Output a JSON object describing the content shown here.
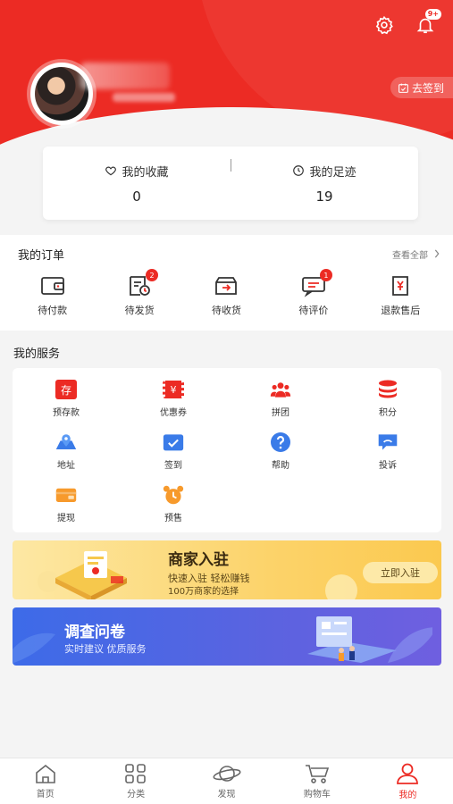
{
  "header": {
    "sign_in_label": "去签到",
    "notification_badge": "9+"
  },
  "stats": {
    "favorites": {
      "label": "我的收藏",
      "value": "0"
    },
    "footprints": {
      "label": "我的足迹",
      "value": "19"
    }
  },
  "orders": {
    "title": "我的订单",
    "view_all": "查看全部",
    "items": [
      {
        "label": "待付款",
        "icon": "wallet-icon",
        "badge": ""
      },
      {
        "label": "待发货",
        "icon": "clock-doc-icon",
        "badge": "2"
      },
      {
        "label": "待收货",
        "icon": "truck-box-icon",
        "badge": ""
      },
      {
        "label": "待评价",
        "icon": "comment-icon",
        "badge": "1"
      },
      {
        "label": "退款售后",
        "icon": "refund-icon",
        "badge": ""
      }
    ]
  },
  "services": {
    "title": "我的服务",
    "items": [
      {
        "label": "预存款",
        "icon": "deposit-icon"
      },
      {
        "label": "优惠券",
        "icon": "coupon-icon"
      },
      {
        "label": "拼团",
        "icon": "group-icon"
      },
      {
        "label": "积分",
        "icon": "points-icon"
      },
      {
        "label": "地址",
        "icon": "map-icon"
      },
      {
        "label": "签到",
        "icon": "checkin-icon"
      },
      {
        "label": "帮助",
        "icon": "help-icon"
      },
      {
        "label": "投诉",
        "icon": "complaint-icon"
      },
      {
        "label": "提现",
        "icon": "withdraw-icon"
      },
      {
        "label": "预售",
        "icon": "alarm-clock-icon"
      }
    ],
    "deposit_glyph": "存",
    "coupon_glyph": "¥"
  },
  "merchant_banner": {
    "title": "商家入驻",
    "line1": "快速入驻 轻松赚钱",
    "line2": "100万商家的选择",
    "button": "立即入驻"
  },
  "survey_banner": {
    "title": "调查问卷",
    "subtitle": "实时建议  优质服务"
  },
  "tabbar": [
    {
      "label": "首页",
      "icon": "home-icon",
      "active": false
    },
    {
      "label": "分类",
      "icon": "category-icon",
      "active": false
    },
    {
      "label": "发现",
      "icon": "planet-icon",
      "active": false
    },
    {
      "label": "购物车",
      "icon": "cart-icon",
      "active": false
    },
    {
      "label": "我的",
      "icon": "user-icon",
      "active": true
    }
  ],
  "colors": {
    "brand": "#ec2b24",
    "accent_blue": "#3a7be8",
    "orange": "#f79a2c"
  }
}
